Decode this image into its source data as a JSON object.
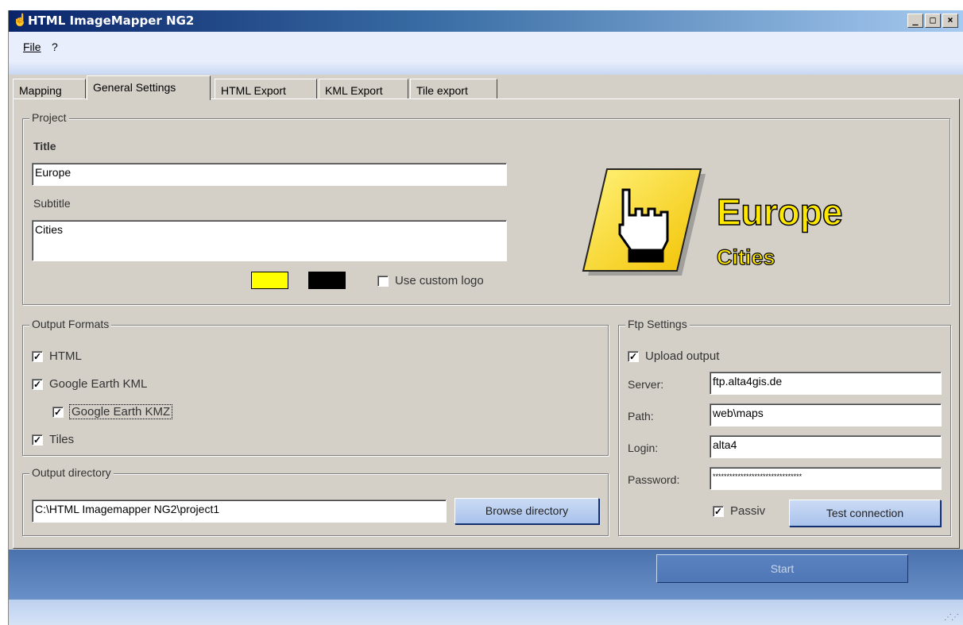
{
  "window": {
    "title": "HTML ImageMapper NG2"
  },
  "titlebar_buttons": {
    "minimize": "_",
    "maximize": "□",
    "close": "×"
  },
  "menu": {
    "file": "File",
    "help": "?"
  },
  "tabs": [
    {
      "label": "Mapping"
    },
    {
      "label": "General Settings"
    },
    {
      "label": "HTML Export"
    },
    {
      "label": "KML Export"
    },
    {
      "label": "Tile export"
    }
  ],
  "active_tab": "General Settings",
  "project": {
    "legend": "Project",
    "title_label": "Title",
    "title_value": "Europe",
    "subtitle_label": "Subtitle",
    "subtitle_value": "Cities",
    "color1": "#ffff00",
    "color2": "#000000",
    "custom_logo_label": "Use custom logo",
    "custom_logo_checked": false,
    "logo_title": "Europe",
    "logo_subtitle": "Cities"
  },
  "output_formats": {
    "legend": "Output Formats",
    "html": {
      "label": "HTML",
      "checked": true
    },
    "kml": {
      "label": "Google Earth KML",
      "checked": true
    },
    "kmz": {
      "label": "Google Earth KMZ",
      "checked": true
    },
    "tiles": {
      "label": "Tiles",
      "checked": true
    }
  },
  "output_directory": {
    "legend": "Output directory",
    "path": "C:\\HTML Imagemapper NG2\\project1",
    "browse_label": "Browse directory"
  },
  "ftp": {
    "legend": "Ftp Settings",
    "upload_label": "Upload output",
    "upload_checked": true,
    "server_label": "Server:",
    "server_value": "ftp.alta4gis.de",
    "path_label": "Path:",
    "path_value": "web\\maps",
    "login_label": "Login:",
    "login_value": "alta4",
    "password_label": "Password:",
    "password_value": "********************************",
    "passiv_label": "Passiv",
    "passiv_checked": true,
    "test_label": "Test connection"
  },
  "start_label": "Start"
}
